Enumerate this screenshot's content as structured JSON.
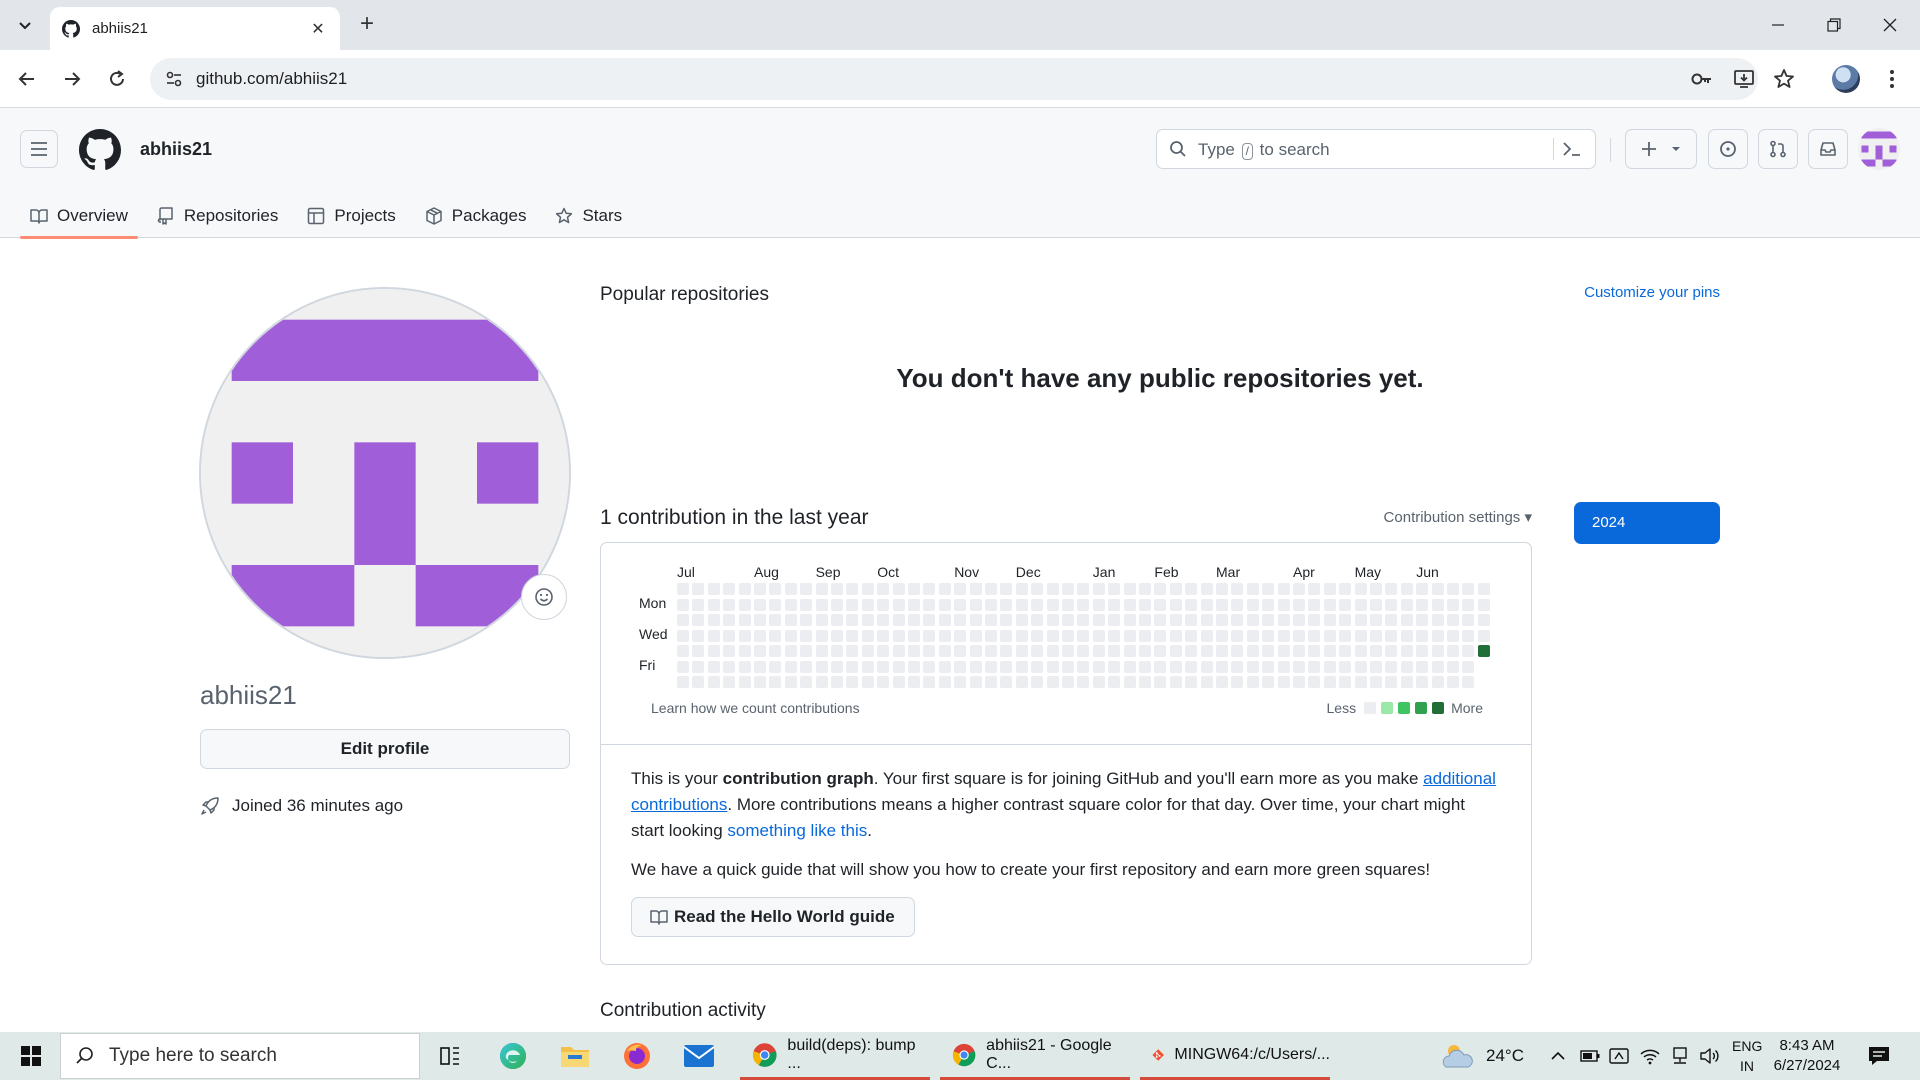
{
  "browser": {
    "tab_title": "abhiis21",
    "url": "github.com/abhiis21"
  },
  "header": {
    "username": "abhiis21",
    "search_prefix": "Type",
    "search_key": "/",
    "search_suffix": "to search"
  },
  "nav_tabs": [
    {
      "label": "Overview",
      "icon": "book-icon"
    },
    {
      "label": "Repositories",
      "icon": "repo-icon"
    },
    {
      "label": "Projects",
      "icon": "table-icon"
    },
    {
      "label": "Packages",
      "icon": "package-icon"
    },
    {
      "label": "Stars",
      "icon": "star-icon"
    }
  ],
  "profile": {
    "name": "abhiis21",
    "edit_button": "Edit profile",
    "joined": "Joined 36 minutes ago",
    "avatar_color": "#a15ed9"
  },
  "popular": {
    "title": "Popular repositories",
    "customize": "Customize your pins",
    "empty": "You don't have any public repositories yet."
  },
  "contributions": {
    "title": "1 contribution in the last year",
    "settings": "Contribution settings ▾",
    "year": "2024",
    "months": [
      "Jul",
      "Aug",
      "Sep",
      "Oct",
      "Nov",
      "Dec",
      "Jan",
      "Feb",
      "Mar",
      "Apr",
      "May",
      "Jun"
    ],
    "days": [
      "Mon",
      "Wed",
      "Fri"
    ],
    "learn": "Learn how we count contributions",
    "legend_less": "Less",
    "legend_more": "More",
    "legend_colors": [
      "#ebedf0",
      "#9be9a8",
      "#40c463",
      "#30a14e",
      "#216e39"
    ],
    "total_weeks": 53,
    "last_week_days": 5,
    "active_day": {
      "week": 53,
      "day": "Thu",
      "level": 4
    }
  },
  "info": {
    "p1_a": "This is your ",
    "p1_bold": "contribution graph",
    "p1_b": ". Your first square is for joining GitHub and you'll earn more as you make ",
    "p1_link1": "additional contributions",
    "p1_c": ". More contributions means a higher contrast square color for that day. Over time, your chart might start looking ",
    "p1_link2": "something like this",
    "p1_d": ".",
    "p2": "We have a quick guide that will show you how to create your first repository and earn more green squares!",
    "guide_button": "Read the Hello World guide"
  },
  "activity": {
    "title": "Contribution activity"
  },
  "taskbar": {
    "search_placeholder": "Type here to search",
    "apps": [
      {
        "label": "build(deps): bump ...",
        "icon": "chrome-icon"
      },
      {
        "label": "abhiis21 - Google C...",
        "icon": "chrome-icon"
      },
      {
        "label": "MINGW64:/c/Users/...",
        "icon": "git-bash-icon"
      }
    ],
    "weather": "24°C",
    "lang1": "ENG",
    "lang2": "IN",
    "time": "8:43 AM",
    "date": "6/27/2024"
  }
}
